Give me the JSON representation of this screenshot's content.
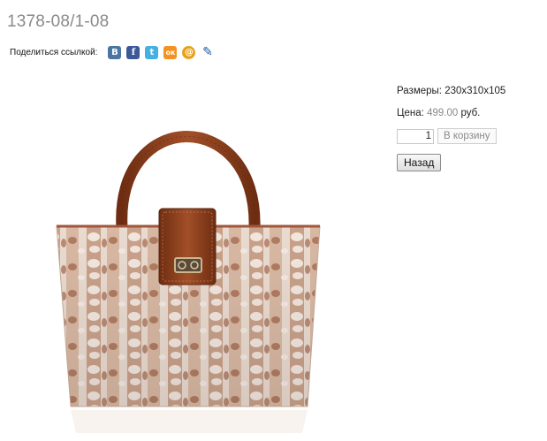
{
  "product": {
    "title": "1378-08/1-08",
    "image_alt": "handbag-image"
  },
  "share": {
    "label": "Поделиться ссылкой:",
    "icons": [
      {
        "name": "vkontakte-icon",
        "glyph": "B"
      },
      {
        "name": "facebook-icon",
        "glyph": "f"
      },
      {
        "name": "twitter-icon",
        "glyph": "t"
      },
      {
        "name": "odnoklassniki-icon",
        "glyph": "ок"
      },
      {
        "name": "mail-ru-icon",
        "glyph": "@"
      },
      {
        "name": "livejournal-icon",
        "glyph": "✎"
      }
    ]
  },
  "info": {
    "sizes_label": "Размеры:",
    "sizes_value": "230x310x105",
    "price_label": "Цена:",
    "price_value": "499.00",
    "price_currency": "руб.",
    "quantity": "1",
    "add_to_cart_label": "В корзину",
    "back_label": "Назад"
  },
  "colors": {
    "title": "#8a8a8a",
    "price": "#8a8a8a",
    "leather": "#8b3f1c",
    "pattern_light": "#efe3da",
    "pattern_dark": "#b98a70"
  }
}
